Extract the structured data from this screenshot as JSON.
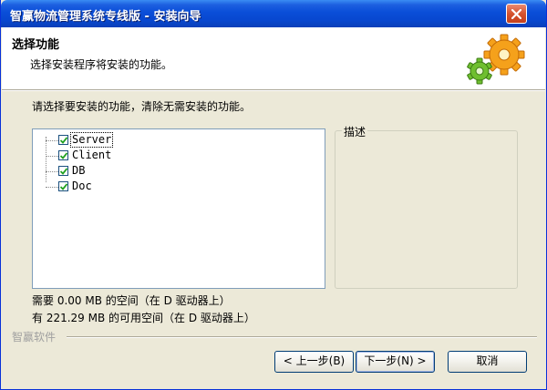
{
  "window": {
    "title": "智赢物流管理系统专线版 - 安装向导"
  },
  "header": {
    "title": "选择功能",
    "subtitle": "选择安装程序将安装的功能。"
  },
  "instruction": "请选择要安装的功能，清除无需安装的功能。",
  "features": [
    {
      "label": "Server",
      "checked": true,
      "selected": true
    },
    {
      "label": "Client",
      "checked": true,
      "selected": false
    },
    {
      "label": "DB",
      "checked": true,
      "selected": false
    },
    {
      "label": "Doc",
      "checked": true,
      "selected": false
    }
  ],
  "description": {
    "label": "描述"
  },
  "space": {
    "required": "需要 0.00 MB 的空间（在 D 驱动器上）",
    "available": "有 221.29 MB 的可用空间（在 D 驱动器上）"
  },
  "brand": "智赢软件",
  "buttons": {
    "back": "< 上一步(B)",
    "next": "下一步(N) >",
    "cancel": "取消"
  },
  "icons": {
    "close": "close-icon",
    "gears": "gears-icon",
    "checkbox": "check-icon"
  }
}
